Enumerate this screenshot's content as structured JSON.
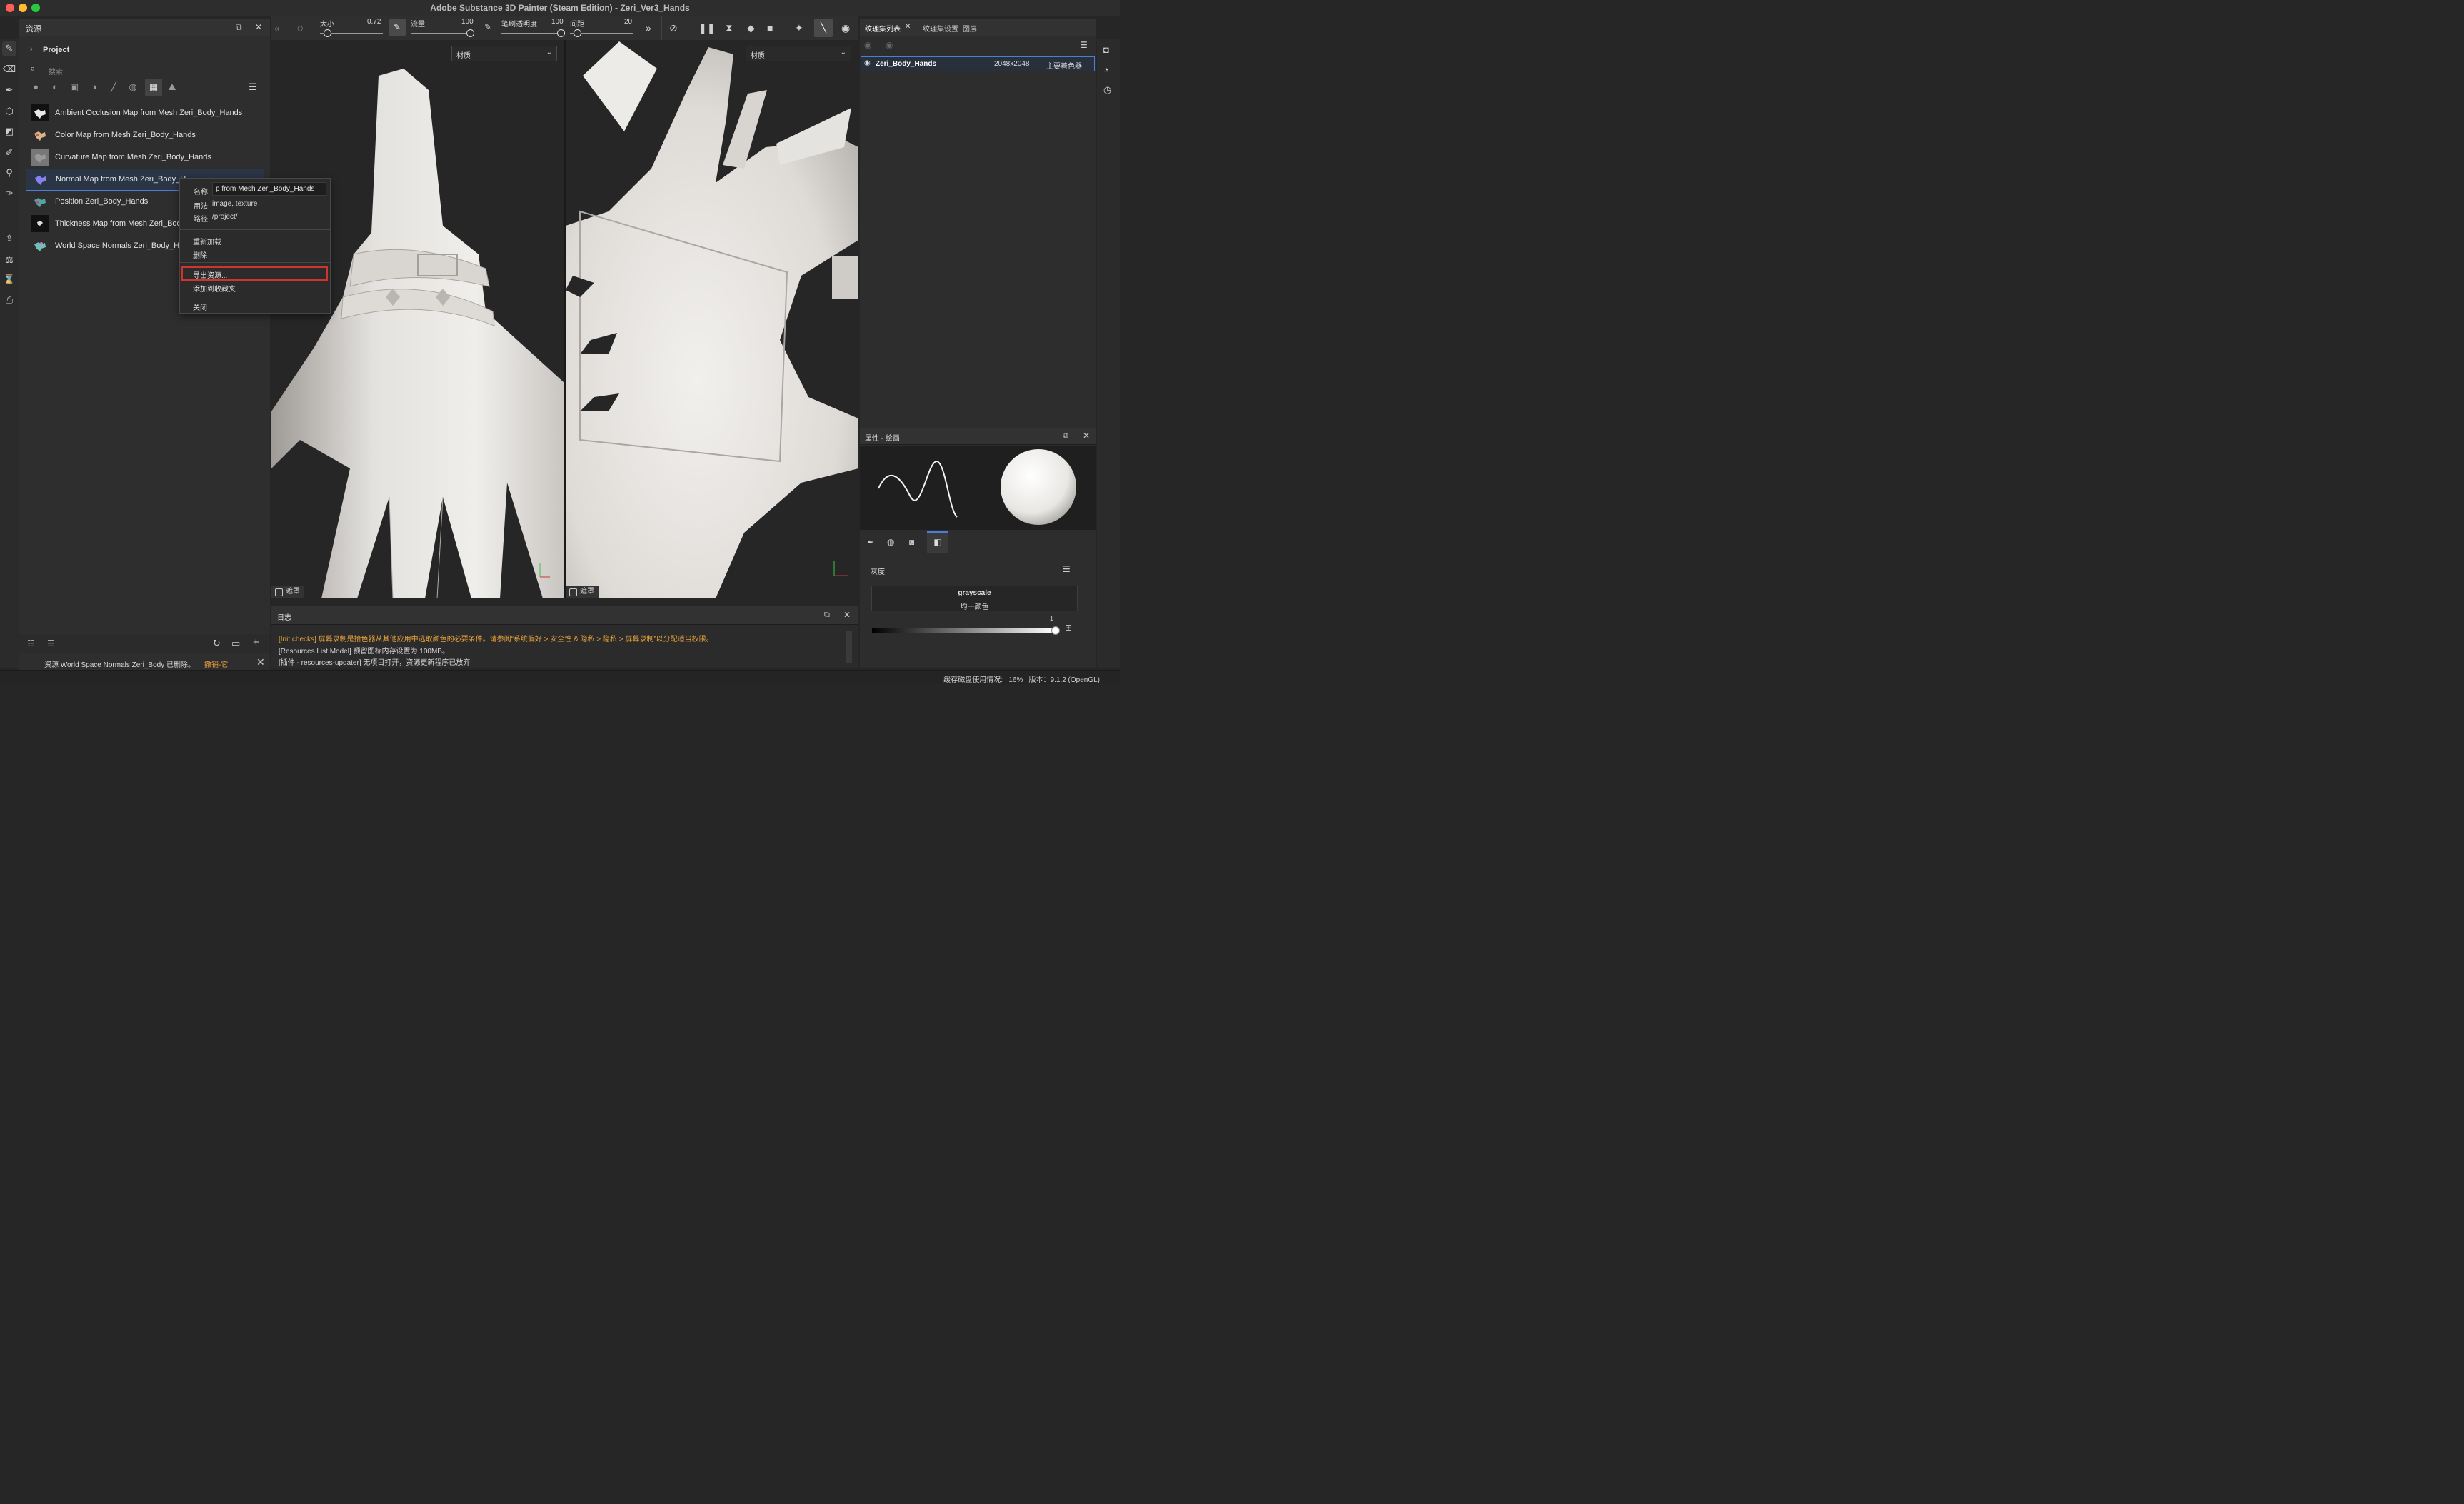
{
  "window": {
    "title": "Adobe Substance 3D Painter (Steam Edition) - Zeri_Ver3_Hands"
  },
  "assets_panel": {
    "title": "资源",
    "project_label": "Project",
    "search_placeholder": "搜索",
    "items": [
      {
        "label": "Ambient Occlusion Map from Mesh Zeri_Body_Hands"
      },
      {
        "label": "Color Map from Mesh Zeri_Body_Hands"
      },
      {
        "label": "Curvature Map from Mesh Zeri_Body_Hands"
      },
      {
        "label": "Normal Map from Mesh Zeri_Body_H..."
      },
      {
        "label": "Position Zeri_Body_Hands"
      },
      {
        "label": "Thickness Map from Mesh Zeri_Body"
      },
      {
        "label": "World Space Normals Zeri_Body_Ha"
      }
    ],
    "notice_text": "资源 World Space Normals Zeri_Body 已删除。",
    "undo_label": "撤销-它"
  },
  "context_menu": {
    "name_key": "名称",
    "name_value": "p from Mesh Zeri_Body_Hands",
    "usage_key": "用法",
    "usage_value": "image, texture",
    "path_key": "路径",
    "path_value": "/project/",
    "reload": "重新加载",
    "delete": "删除",
    "export": "导出资源...",
    "add_favorite": "添加到收藏夹",
    "close": "关闭"
  },
  "toolbar": {
    "size_label": "大小",
    "size_value": "0.72",
    "flow_label": "流量",
    "flow_value": "100",
    "opacity_label": "笔刷透明度",
    "opacity_value": "100",
    "spacing_label": "间距",
    "spacing_value": "20"
  },
  "viewport_left": {
    "material": "材质",
    "mask": "遮罩"
  },
  "viewport_right": {
    "material": "材质",
    "mask": "遮罩"
  },
  "texture_sets": {
    "tabs": [
      "纹理集列表",
      "纹理集设置",
      "图层"
    ],
    "rows": [
      {
        "name": "Zeri_Body_Hands",
        "resolution": "2048x2048",
        "shader": "主要着色器"
      }
    ]
  },
  "properties": {
    "title": "属性 - 绘画",
    "section": "灰度",
    "channel_name": "grayscale",
    "channel_mode": "均一颜色",
    "slider_value": "1",
    "slider_level": 1.0
  },
  "log": {
    "title": "日志",
    "lines": [
      "[Init checks] 屏幕录制是拾色器从其他应用中选取颜色的必要条件。请参阅“系统偏好 > 安全性 & 隐私 > 隐私 > 屏幕录制”以分配适当权限。",
      "[Resources List Model] 预留图标内存设置为 100MB。",
      "[插件 - resources-updater] 无项目打开，资源更新程序已放弃"
    ]
  },
  "status_bar": {
    "text": "缓存磁盘使用情况:   16% | 版本：9.1.2 (OpenGL)"
  },
  "colors": {
    "accent_blue": "#4a7ed9",
    "highlight_red": "#d0342c",
    "log_warning": "#e8a33a"
  }
}
